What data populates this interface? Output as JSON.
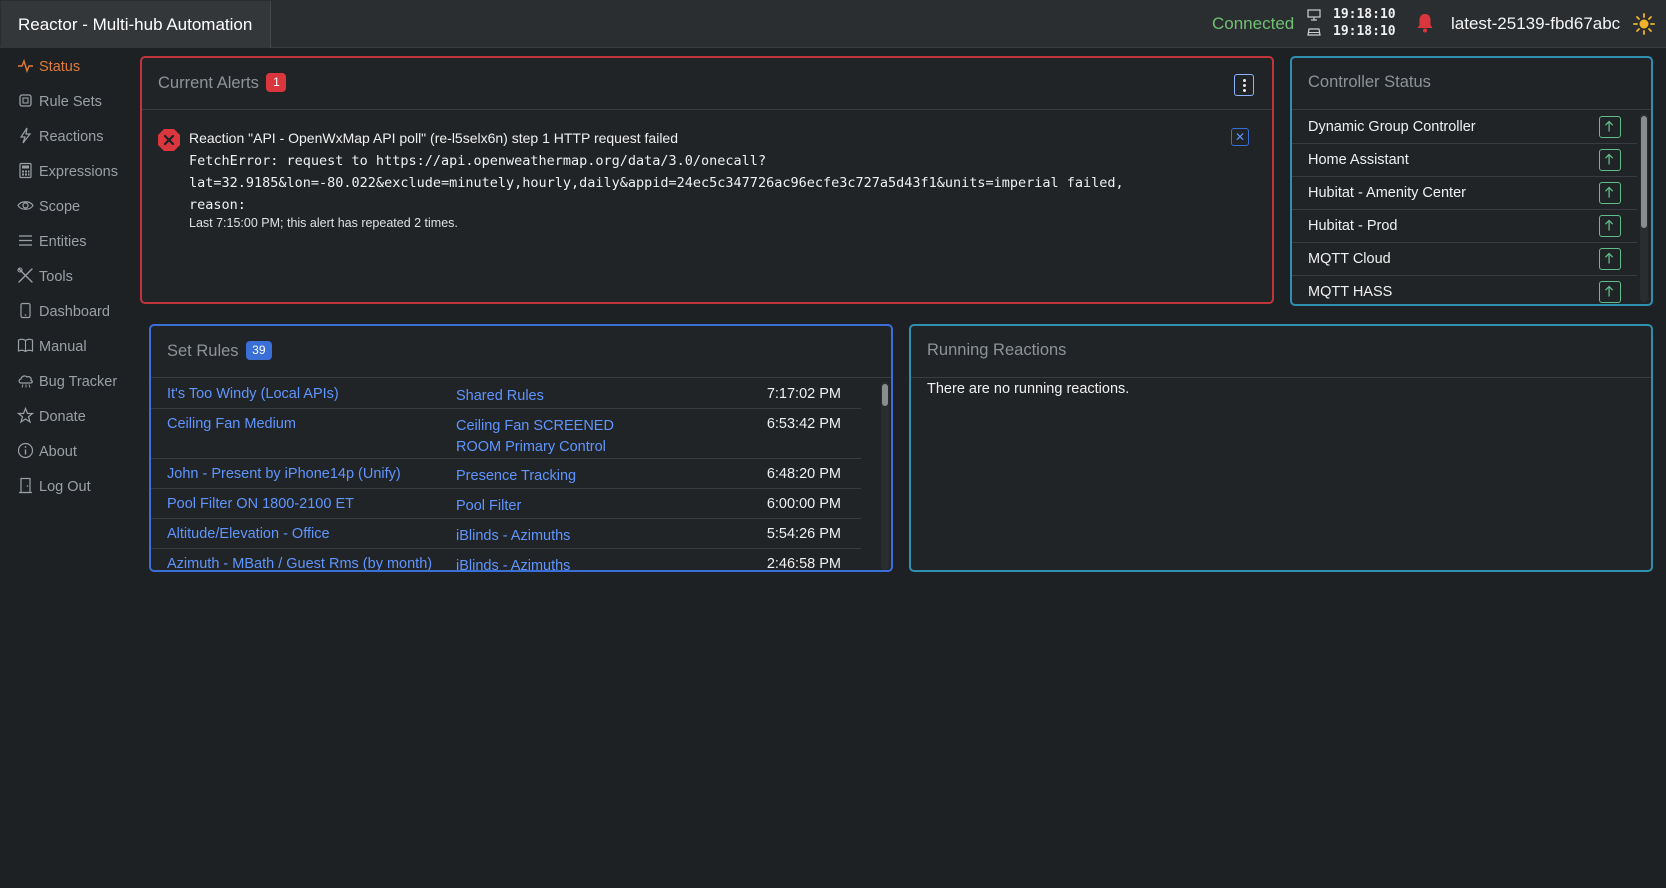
{
  "app": {
    "title": "Reactor - Multi-hub Automation",
    "connection_status": "Connected",
    "clock_client": "19:18:10",
    "clock_server": "19:18:10",
    "version": "latest-25139-fbd67abc"
  },
  "sidebar": {
    "items": [
      {
        "label": "Status",
        "icon": "activity-icon",
        "active": true
      },
      {
        "label": "Rule Sets",
        "icon": "chip-icon"
      },
      {
        "label": "Reactions",
        "icon": "lightning-icon"
      },
      {
        "label": "Expressions",
        "icon": "calculator-icon"
      },
      {
        "label": "Scope",
        "icon": "eye-icon"
      },
      {
        "label": "Entities",
        "icon": "list-icon"
      },
      {
        "label": "Tools",
        "icon": "tools-icon"
      },
      {
        "label": "Dashboard",
        "icon": "tablet-icon"
      },
      {
        "label": "Manual",
        "icon": "book-icon"
      },
      {
        "label": "Bug Tracker",
        "icon": "cloud-bug-icon"
      },
      {
        "label": "Donate",
        "icon": "star-icon"
      },
      {
        "label": "About",
        "icon": "info-icon"
      },
      {
        "label": "Log Out",
        "icon": "door-icon"
      }
    ]
  },
  "alerts": {
    "title": "Current Alerts",
    "count": "1",
    "items": [
      {
        "title": "Reaction \"API - OpenWxMap API poll\" (re-l5selx6n) step 1 HTTP request failed",
        "message": "FetchError: request to https://api.openweathermap.org/data/3.0/onecall?\nlat=32.9185&lon=-80.022&exclude=minutely,hourly,daily&appid=24ec5c347726ac96ecfe3c727a5d43f1&units=imperial failed,\nreason:",
        "footer": "Last 7:15:00 PM; this alert has repeated 2 times."
      }
    ]
  },
  "controllers": {
    "title": "Controller Status",
    "items": [
      {
        "name": "Dynamic Group Controller"
      },
      {
        "name": "Home Assistant"
      },
      {
        "name": "Hubitat - Amenity Center"
      },
      {
        "name": "Hubitat - Prod"
      },
      {
        "name": "MQTT Cloud"
      },
      {
        "name": "MQTT HASS"
      }
    ]
  },
  "set_rules": {
    "title": "Set Rules",
    "count": "39",
    "rows": [
      {
        "name": "It's Too Windy (Local APIs)",
        "ruleset": "Shared Rules",
        "time": "7:17:02 PM"
      },
      {
        "name": "Ceiling Fan Medium",
        "ruleset": "Ceiling Fan SCREENED ROOM Primary Control",
        "time": "6:53:42 PM"
      },
      {
        "name": "John - Present by iPhone14p (Unify)",
        "ruleset": "Presence Tracking",
        "time": "6:48:20 PM"
      },
      {
        "name": "Pool Filter ON 1800-2100 ET",
        "ruleset": "Pool Filter",
        "time": "6:00:00 PM"
      },
      {
        "name": "Altitude/Elevation - Office",
        "ruleset": "iBlinds - Azimuths",
        "time": "5:54:26 PM"
      },
      {
        "name": "Azimuth - MBath / Guest Rms (by month)",
        "ruleset": "iBlinds - Azimuths",
        "time": "2:46:58 PM"
      }
    ]
  },
  "running": {
    "title": "Running Reactions",
    "empty_message": "There are no running reactions."
  },
  "colors": {
    "accent_active": "#e07b39",
    "link": "#5f95ff",
    "alert_border": "#c0343a",
    "connected": "#6fbf73",
    "bell": "#d9363e"
  }
}
